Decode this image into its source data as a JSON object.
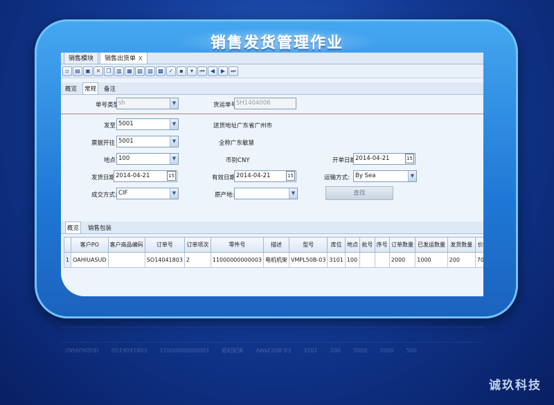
{
  "banner_title": "销售发货管理作业",
  "tabs": [
    {
      "label": "销售模块",
      "active": false
    },
    {
      "label": "销售出货单",
      "active": true,
      "close": "X"
    }
  ],
  "toolbar_icons": [
    "new-icon",
    "open-icon",
    "save-icon",
    "delete-icon",
    "copy-icon",
    "paste-icon",
    "print-icon",
    "preview-icon",
    "export-icon",
    "import-icon",
    "check-icon",
    "attach-icon",
    "filter-icon",
    "first-icon",
    "prev-icon",
    "next-icon",
    "last-icon"
  ],
  "subtabs": [
    {
      "label": "概览",
      "active": false
    },
    {
      "label": "常规",
      "active": true
    },
    {
      "label": "备注",
      "active": false
    }
  ],
  "form": {
    "doc_type": {
      "label": "单号类型",
      "value": "sh"
    },
    "shipment_no": {
      "label": "货运单号",
      "value": "SH1404006"
    },
    "ship_to": {
      "label": "发至",
      "value": "5001"
    },
    "delivery_addr": {
      "label": "送货地址",
      "value": "广东省广州市"
    },
    "bill_to": {
      "label": "票据开往",
      "value": "5001"
    },
    "full_name": {
      "label": "全称",
      "value": "广东敏慧"
    },
    "location": {
      "label": "地点",
      "value": "100"
    },
    "currency": {
      "label": "币别",
      "value": "CNY"
    },
    "open_date": {
      "label": "开单日期",
      "value": "2014-04-21"
    },
    "ship_date": {
      "label": "发货日期",
      "value": "2014-04-21"
    },
    "valid_date": {
      "label": "有效日期",
      "value": "2014-04-21"
    },
    "transport": {
      "label": "运输方式:",
      "value": "By Sea"
    },
    "deal_mode": {
      "label": "成交方式:",
      "value": "CIF"
    },
    "origin": {
      "label": "原产地:",
      "value": ""
    },
    "action_button": "查找",
    "calendar_day": "15"
  },
  "bottom_tabs": [
    {
      "label": "概览",
      "active": true
    },
    {
      "label": "销售包装",
      "active": false
    }
  ],
  "grid": {
    "columns": [
      "客户PO",
      "客户商品编码",
      "订单号",
      "订单项次",
      "零件号",
      "描述",
      "型号",
      "库位",
      "地点",
      "批号",
      "序号",
      "订单数量",
      "已发运数量",
      "发货数量",
      "价"
    ],
    "rows": [
      [
        "1",
        "OAHIUASUD",
        "",
        "SO14041803",
        "2",
        "11000000000003",
        "电机机架",
        "VMPL50B-03",
        "3101",
        "100",
        "",
        "",
        "2000",
        "1000",
        "200",
        "70"
      ]
    ]
  },
  "reflection_text": [
    "OAHIUASUD",
    "SO14041803",
    "11000000000003",
    "电机机架",
    "VMPL50B-03",
    "3101",
    "100",
    "2000",
    "1000",
    "200"
  ],
  "brand": "诚玖科技"
}
